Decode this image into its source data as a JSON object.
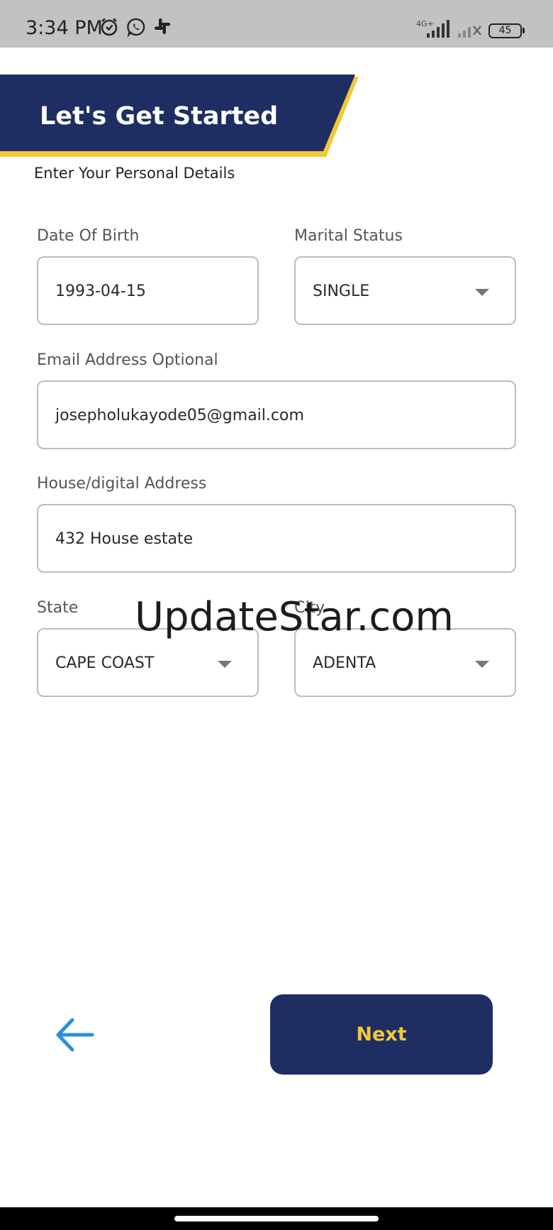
{
  "status_bar": {
    "time": "3:34 PM",
    "network": "4G+",
    "battery": "45",
    "icons": [
      "alarm-icon",
      "whatsapp-icon",
      "slack-icon",
      "signal-icon",
      "signal-off-icon",
      "battery-icon"
    ]
  },
  "header": {
    "title": "Let's Get Started",
    "subtitle": "Enter Your Personal Details"
  },
  "form": {
    "date_of_birth": {
      "label": "Date Of Birth",
      "value": "1993-04-15"
    },
    "marital_status": {
      "label": "Marital Status",
      "value": "SINGLE"
    },
    "email": {
      "label": "Email Address Optional",
      "value": "josepholukayode05@gmail.com"
    },
    "address": {
      "label": "House/digital Address",
      "value": "432 House estate"
    },
    "state": {
      "label": "State",
      "value": "CAPE COAST"
    },
    "city": {
      "label": "City",
      "value": "ADENTA"
    }
  },
  "watermark": "UpdateStar.com",
  "footer": {
    "next_label": "Next",
    "back_icon": "arrow-left-icon"
  },
  "colors": {
    "navy": "#1e2d62",
    "yellow": "#f2c837",
    "arrow_blue": "#2b8fe0",
    "status_bar": "#c2c2c2"
  }
}
